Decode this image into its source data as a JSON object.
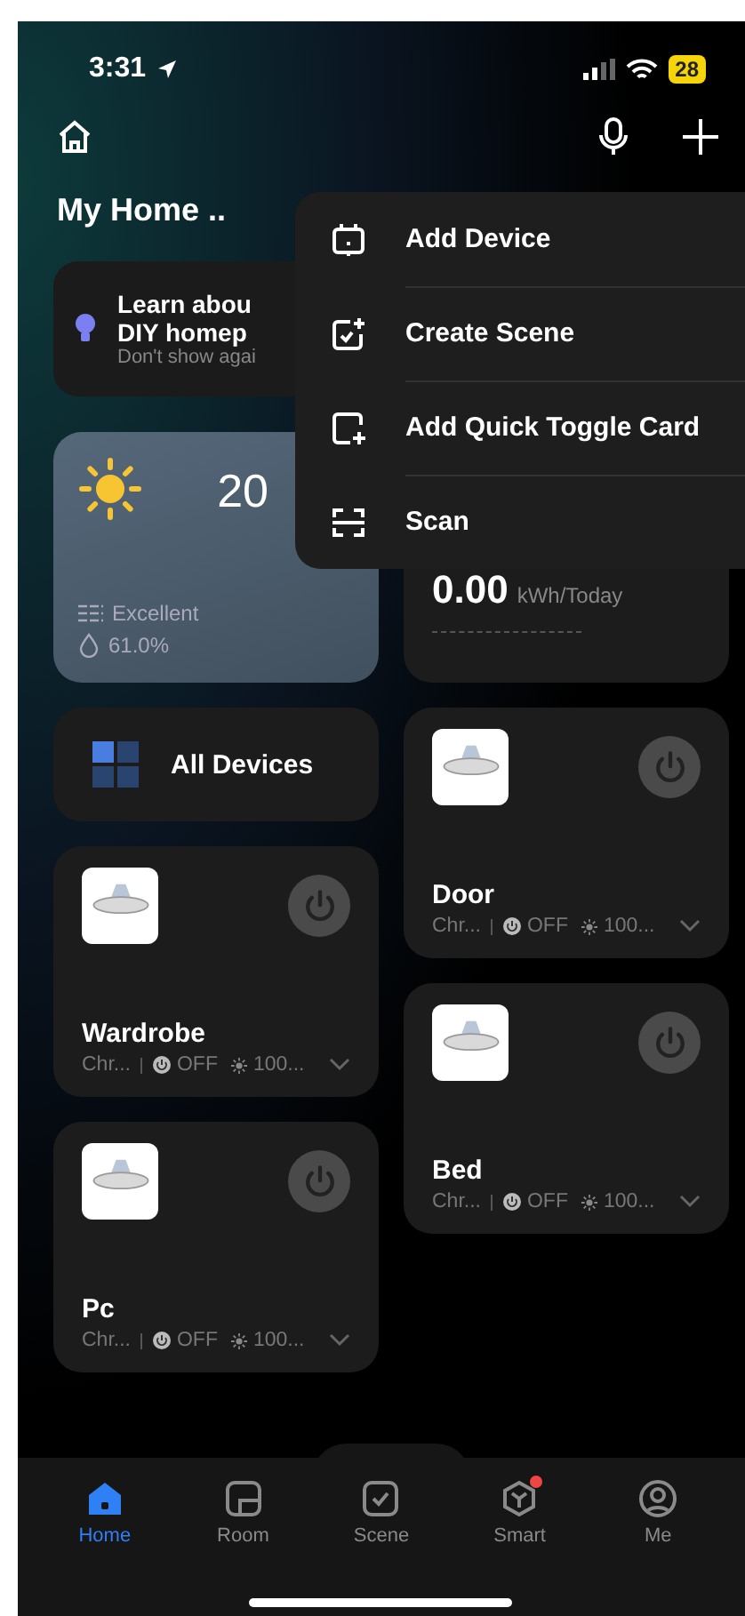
{
  "status_bar": {
    "time": "3:31",
    "battery": "28"
  },
  "header": {
    "title": "My Home .."
  },
  "tip": {
    "title": "Learn abou\nDIY homep",
    "subtitle": "Don't show agai"
  },
  "weather": {
    "temperature": "20",
    "air": "Excellent",
    "humidity": "61.0%"
  },
  "energy": {
    "value": "0.00",
    "unit": "kWh/Today"
  },
  "all_devices": {
    "label": "All Devices"
  },
  "left_devices": [
    {
      "name": "Wardrobe",
      "model": "Chr...",
      "status": "OFF",
      "brightness": "100...",
      "on": false
    },
    {
      "name": "Pc",
      "model": "Chr...",
      "status": "OFF",
      "brightness": "100...",
      "on": false
    }
  ],
  "right_devices": [
    {
      "name": "Door",
      "model": "Chr...",
      "status": "OFF",
      "brightness": "100...",
      "on": false
    },
    {
      "name": "Bed",
      "model": "Chr...",
      "status": "OFF",
      "brightness": "100...",
      "on": false
    }
  ],
  "menu": [
    {
      "kind": "device",
      "label": "Add Device"
    },
    {
      "kind": "scene",
      "label": "Create Scene"
    },
    {
      "kind": "card",
      "label": "Add Quick Toggle Card"
    },
    {
      "kind": "scan",
      "label": "Scan"
    }
  ],
  "nav": [
    {
      "kind": "home",
      "label": "Home",
      "selected": true,
      "dot": false
    },
    {
      "kind": "room",
      "label": "Room",
      "selected": false,
      "dot": false
    },
    {
      "kind": "scene",
      "label": "Scene",
      "selected": false,
      "dot": false
    },
    {
      "kind": "smart",
      "label": "Smart",
      "selected": false,
      "dot": true
    },
    {
      "kind": "me",
      "label": "Me",
      "selected": false,
      "dot": false
    }
  ]
}
